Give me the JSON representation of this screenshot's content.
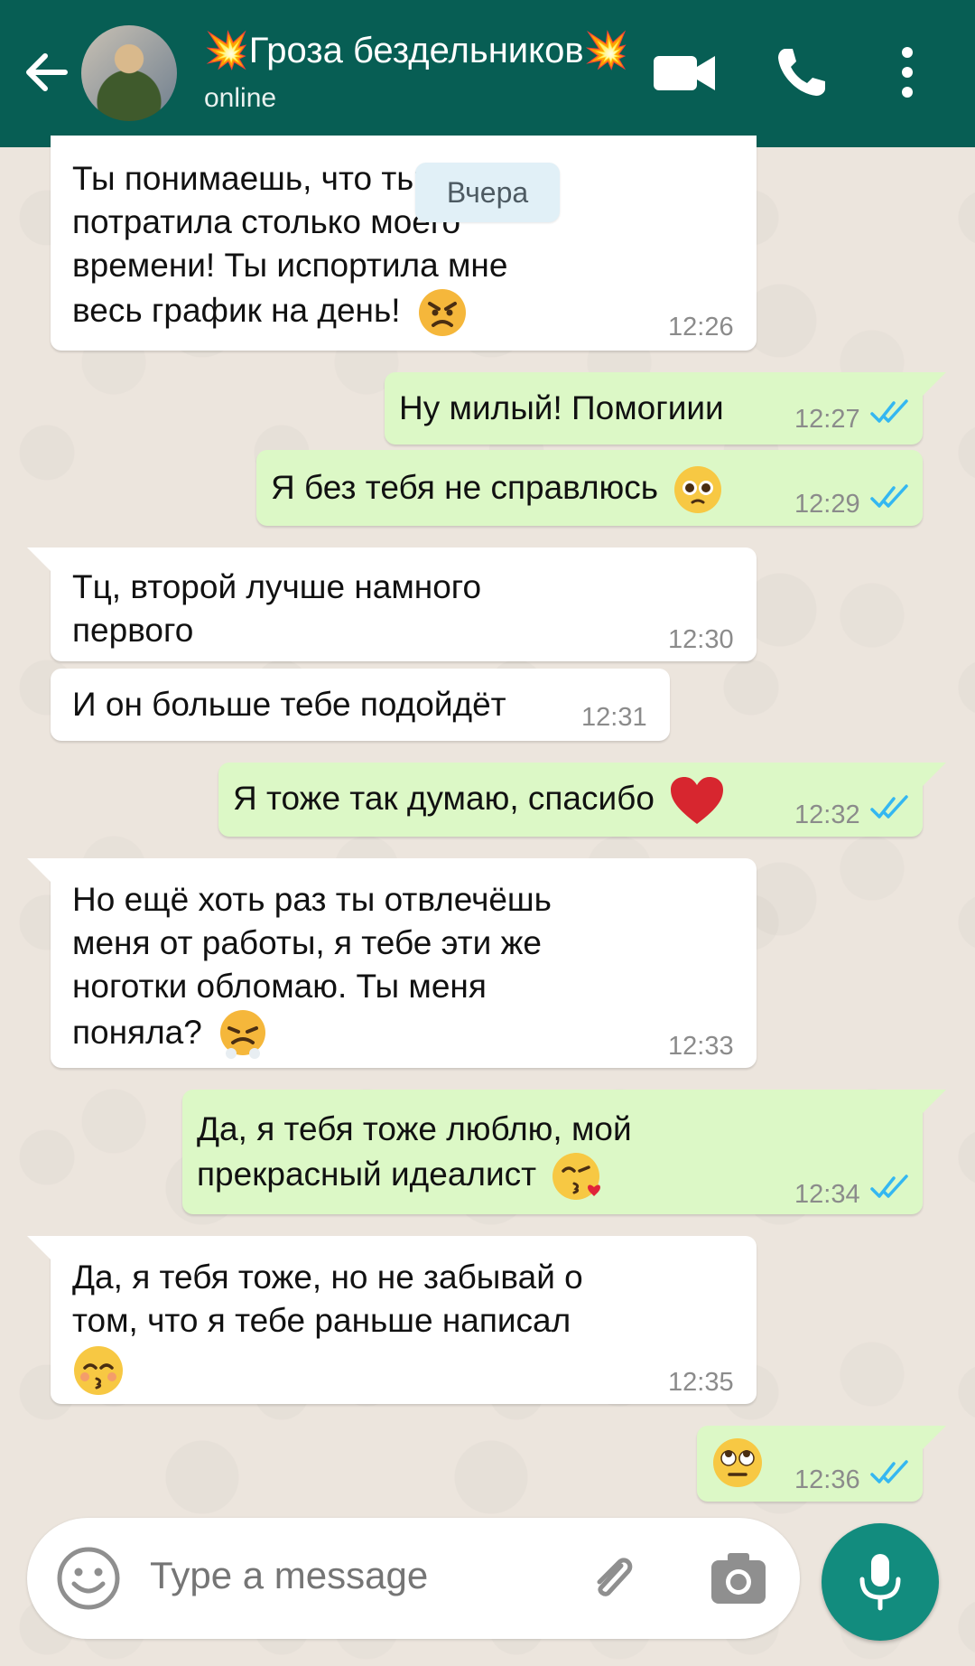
{
  "header": {
    "contact_name": "💥Гроза бездельников💥",
    "status": "online"
  },
  "date_divider": "Вчера",
  "messages": [
    {
      "dir": "in",
      "lines": [
        "Ты понимаешь, что ты",
        "потратила столько моего",
        "времени! Ты испортила мне",
        "весь график на день!"
      ],
      "emoji": "angry-face",
      "time": "12:26"
    },
    {
      "dir": "out",
      "lines": [
        "Ну милый! Помогиии"
      ],
      "time": "12:27",
      "status": "read"
    },
    {
      "dir": "out",
      "lines": [
        "Я без тебя не справлюсь"
      ],
      "emoji": "pleading-face",
      "time": "12:29",
      "status": "read"
    },
    {
      "dir": "in",
      "lines": [
        "Тц, второй лучше намного",
        "первого"
      ],
      "time": "12:30"
    },
    {
      "dir": "in",
      "lines": [
        "И он больше тебе подойдёт"
      ],
      "time": "12:31"
    },
    {
      "dir": "out",
      "lines": [
        "Я тоже так думаю, спасибо"
      ],
      "emoji": "red-heart",
      "time": "12:32",
      "status": "read"
    },
    {
      "dir": "in",
      "lines": [
        "Но ещё хоть раз ты отвлечёшь",
        "меня от работы, я тебе эти же",
        "ноготки обломаю. Ты меня",
        "поняла?"
      ],
      "emoji": "steam-nose-face",
      "time": "12:33"
    },
    {
      "dir": "out",
      "lines": [
        "Да, я тебя тоже люблю, мой",
        "прекрасный идеалист"
      ],
      "emoji": "kiss-face",
      "time": "12:34",
      "status": "read"
    },
    {
      "dir": "in",
      "lines": [
        "Да, я тебя тоже, но не забывай о",
        "том, что я тебе раньше написал"
      ],
      "emoji": "kissing-smiling-eyes-face",
      "time": "12:35"
    },
    {
      "dir": "out",
      "lines": [],
      "emoji": "eye-roll-face",
      "time": "12:36",
      "status": "read"
    }
  ],
  "input": {
    "placeholder": "Type a message"
  },
  "colors": {
    "header": "#075e54",
    "outgoing_bubble": "#dcf8c6",
    "incoming_bubble": "#ffffff",
    "read_ticks": "#34b7f1",
    "mic_button": "#128c7e"
  }
}
